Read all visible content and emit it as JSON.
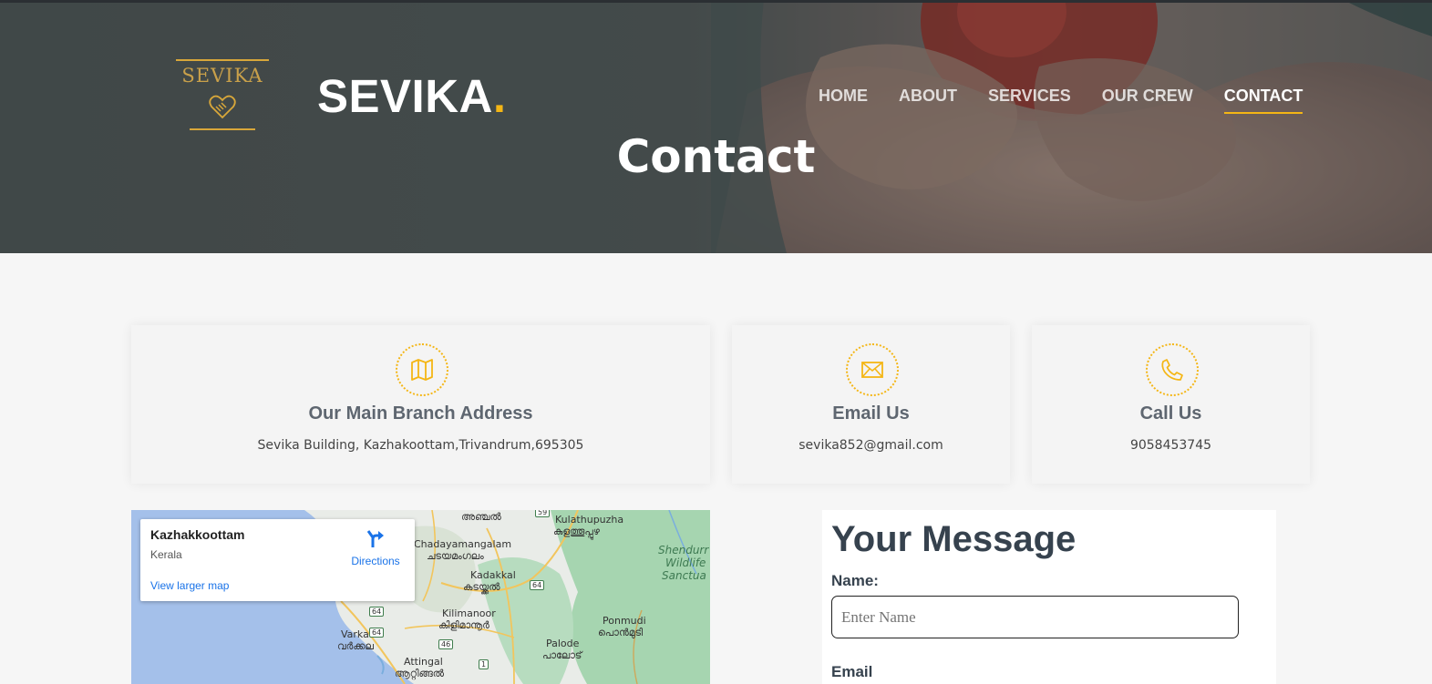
{
  "header": {
    "logo_text": "SEVIKA",
    "brand": "SEVIKA",
    "brand_dot": ".",
    "nav": [
      {
        "label": "HOME"
      },
      {
        "label": "ABOUT"
      },
      {
        "label": "SERVICES"
      },
      {
        "label": "OUR CREW"
      },
      {
        "label": "CONTACT",
        "active": true
      }
    ],
    "page_title": "Contact"
  },
  "info_cards": [
    {
      "icon": "map-icon",
      "title": "Our Main Branch Address",
      "text": "Sevika Building, Kazhakoottam,Trivandrum,695305"
    },
    {
      "icon": "envelope-icon",
      "title": "Email Us",
      "text": "sevika852@gmail.com"
    },
    {
      "icon": "phone-icon",
      "title": "Call Us",
      "text": "9058453745"
    }
  ],
  "map": {
    "place": "Kazhakkoottam",
    "region": "Kerala",
    "directions": "Directions",
    "view_larger": "View larger map",
    "labels": {
      "anchal": "അഞ്ചൽ",
      "kulathupuzha": "Kulathupuzha",
      "kulathupuzha_ml": "കുളത്തൂപ്പുഴ",
      "chadayamangalam": "Chadayamangalam",
      "chadayamangalam_ml": "ചടയമംഗലം",
      "kadakkal": "Kadakkal",
      "kadakkal_ml": "കടയ്ക്കൽ",
      "kilimanoor": "Kilimanoor",
      "kilimanoor_ml": "കിളിമാനൂർ",
      "varkala": "Varkala",
      "varkala_ml": "വർക്കല",
      "attingal": "Attingal",
      "attingal_ml": "ആറ്റിങ്ങൽ",
      "palode": "Palode",
      "palode_ml": "പാലോട്",
      "ponmudi": "Ponmudi",
      "ponmudi_ml": "പൊൻമുടി",
      "shendurney_1": "Shendurr",
      "shendurney_2": "Wildlife",
      "shendurney_3": "Sanctua"
    },
    "shields": {
      "s59": "59",
      "s64a": "64",
      "s64b": "64",
      "s64c": "64",
      "s46": "46",
      "s1": "1"
    }
  },
  "form": {
    "title": "Your Message",
    "name_label": "Name:",
    "name_placeholder": "Enter Name",
    "email_label": "Email"
  },
  "colors": {
    "accent": "#f4b615",
    "heading": "#36424e",
    "card_title": "#5e6670",
    "link": "#1a73e8"
  }
}
